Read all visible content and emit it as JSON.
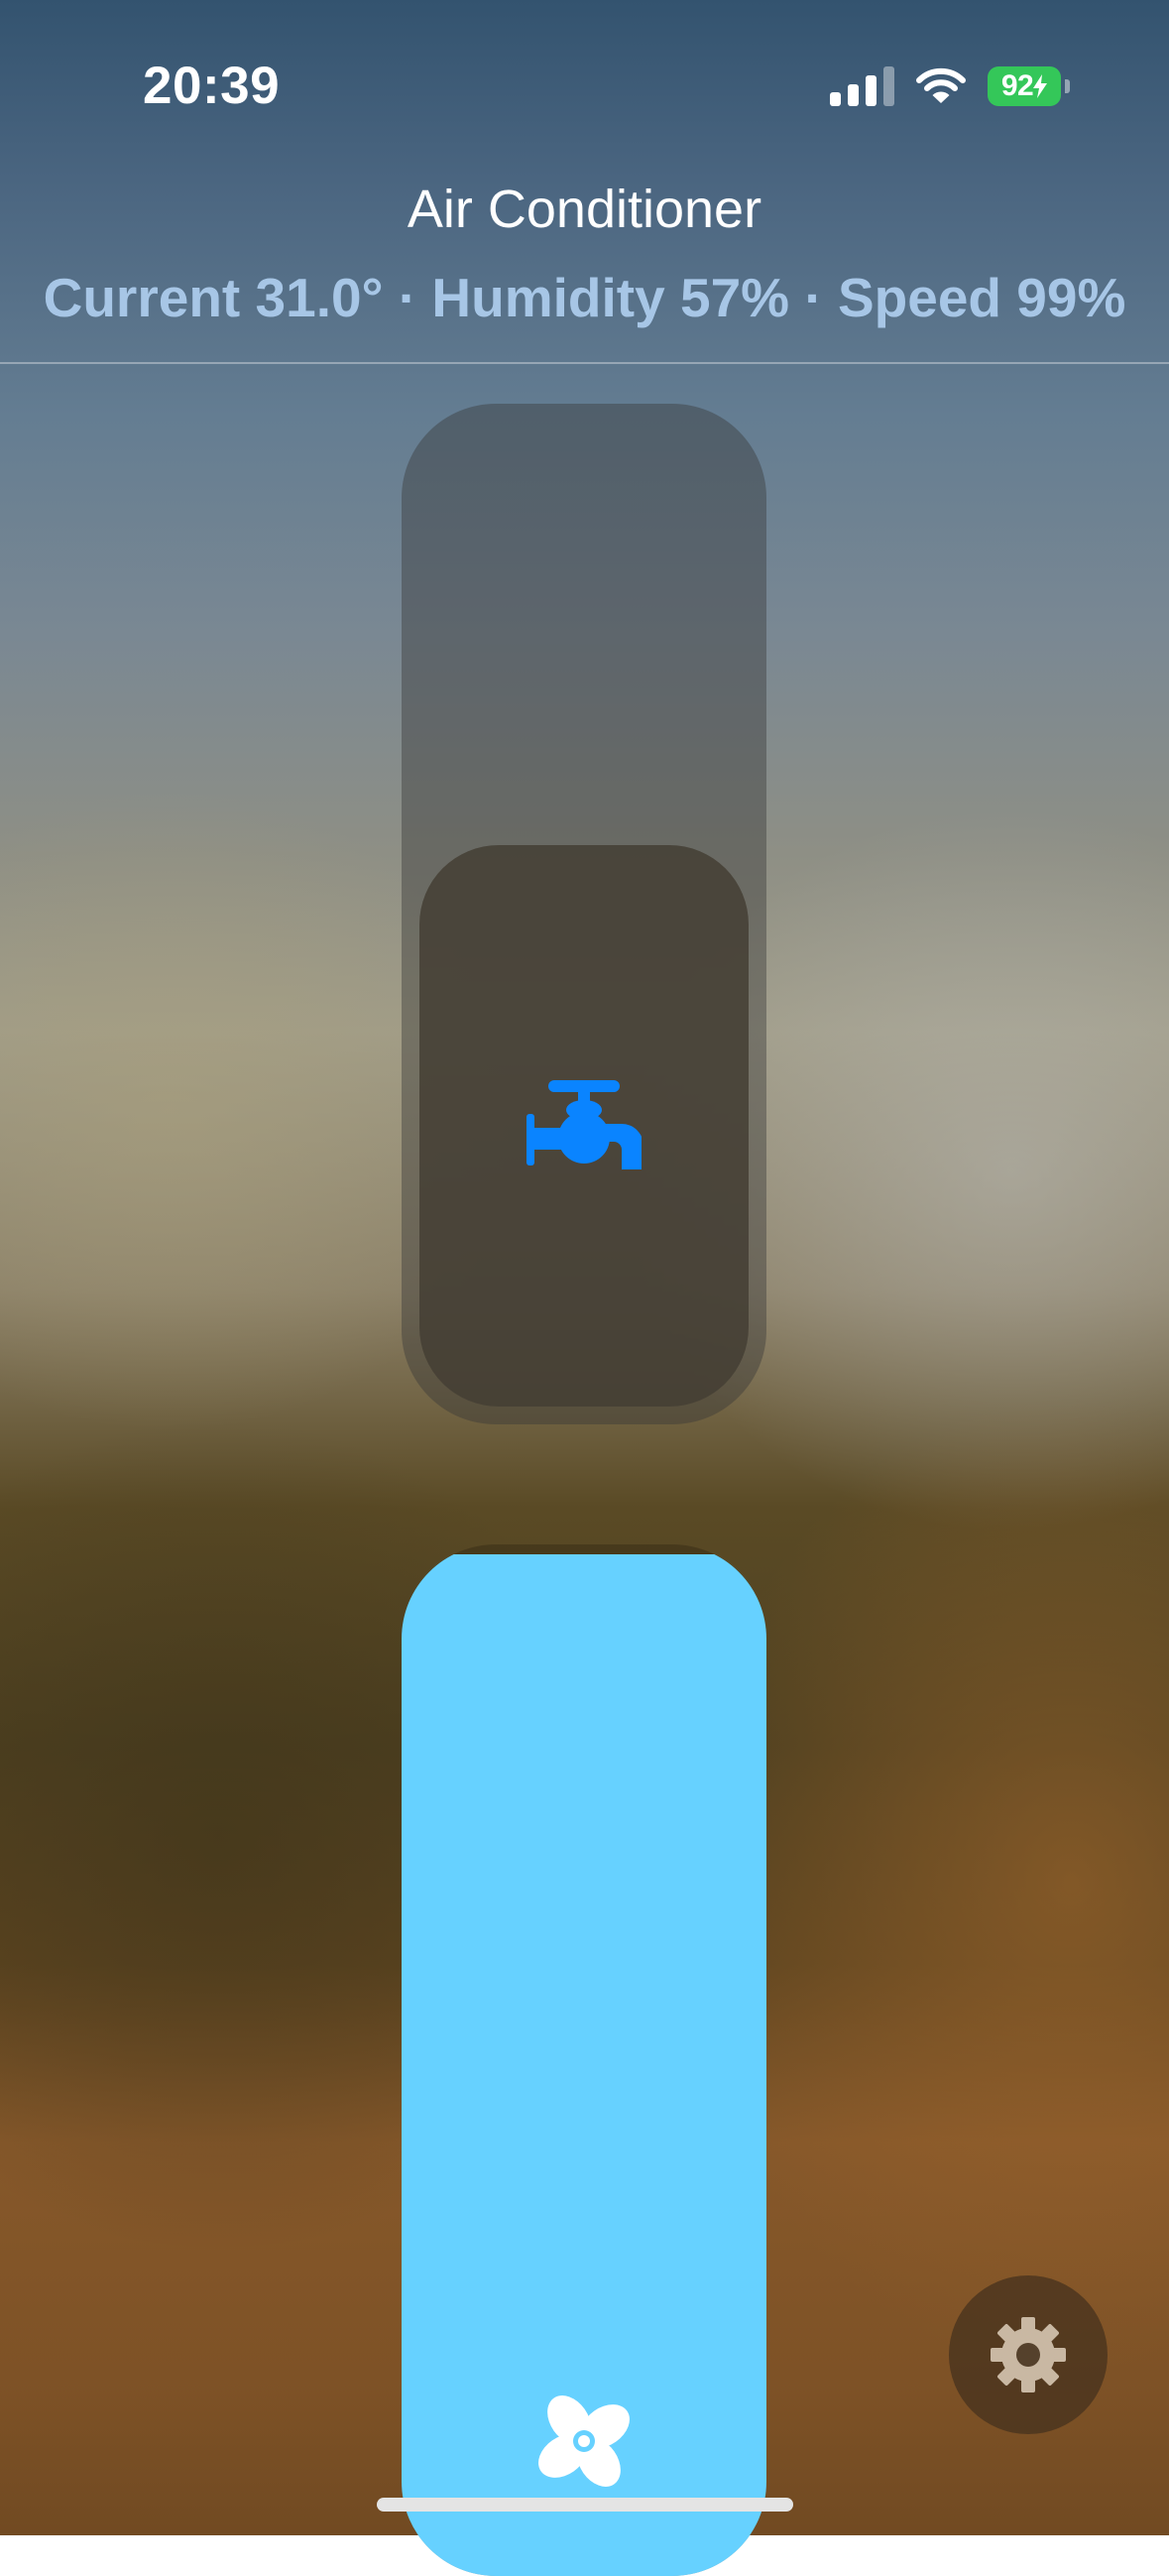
{
  "status_bar": {
    "time": "20:39",
    "battery": "92",
    "signal_bars_active": 3,
    "signal_bars_total": 4,
    "battery_charging": true,
    "battery_color": "#34c759"
  },
  "header": {
    "title": "Air Conditioner",
    "subtitle": "Current 31.0° · Humidity 57% · Speed 99%",
    "subtitle_color": "#a7c6e6"
  },
  "humidity_slider": {
    "icon": "faucet-icon",
    "level": 0.57,
    "icon_color": "#0a84ff"
  },
  "fan_slider": {
    "icon": "fan-icon",
    "level": 0.99,
    "fill_color": "#66d1ff"
  },
  "settings_button": {
    "icon": "gear-icon"
  }
}
